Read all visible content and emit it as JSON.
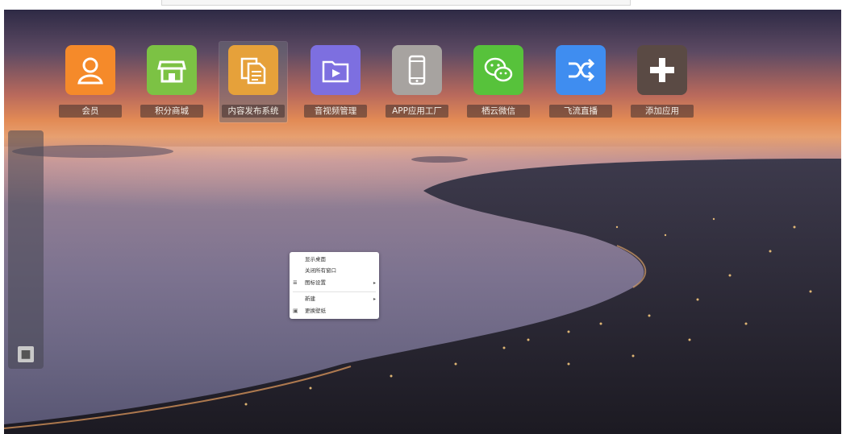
{
  "apps": [
    {
      "label": "会员",
      "icon": "member-icon",
      "color": "#f58a2a"
    },
    {
      "label": "积分商城",
      "icon": "store-icon",
      "color": "#7cc244"
    },
    {
      "label": "内容发布系统",
      "icon": "documents-icon",
      "color": "#e6a13a"
    },
    {
      "label": "音视频管理",
      "icon": "video-folder-icon",
      "color": "#7d6fe0"
    },
    {
      "label": "APP应用工厂",
      "icon": "phone-icon",
      "color": "#a7a3a0"
    },
    {
      "label": "栖云微信",
      "icon": "wechat-icon",
      "color": "#57c23b"
    },
    {
      "label": "飞流直播",
      "icon": "shuffle-icon",
      "color": "#3f8df0"
    },
    {
      "label": "添加应用",
      "icon": "plus-icon",
      "color": "#5a4a44"
    }
  ],
  "context_menu": {
    "items": [
      {
        "label": "显示桌面"
      },
      {
        "label": "关闭所有窗口"
      },
      {
        "label": "图标设置",
        "icon": "sliders-icon",
        "has_submenu": true
      },
      {
        "label": "新建",
        "has_submenu": true
      },
      {
        "label": "更换壁纸",
        "icon": "image-icon"
      }
    ],
    "submenu_arrow": "▸"
  },
  "sidebar": {
    "user_icon": "user-icon"
  }
}
